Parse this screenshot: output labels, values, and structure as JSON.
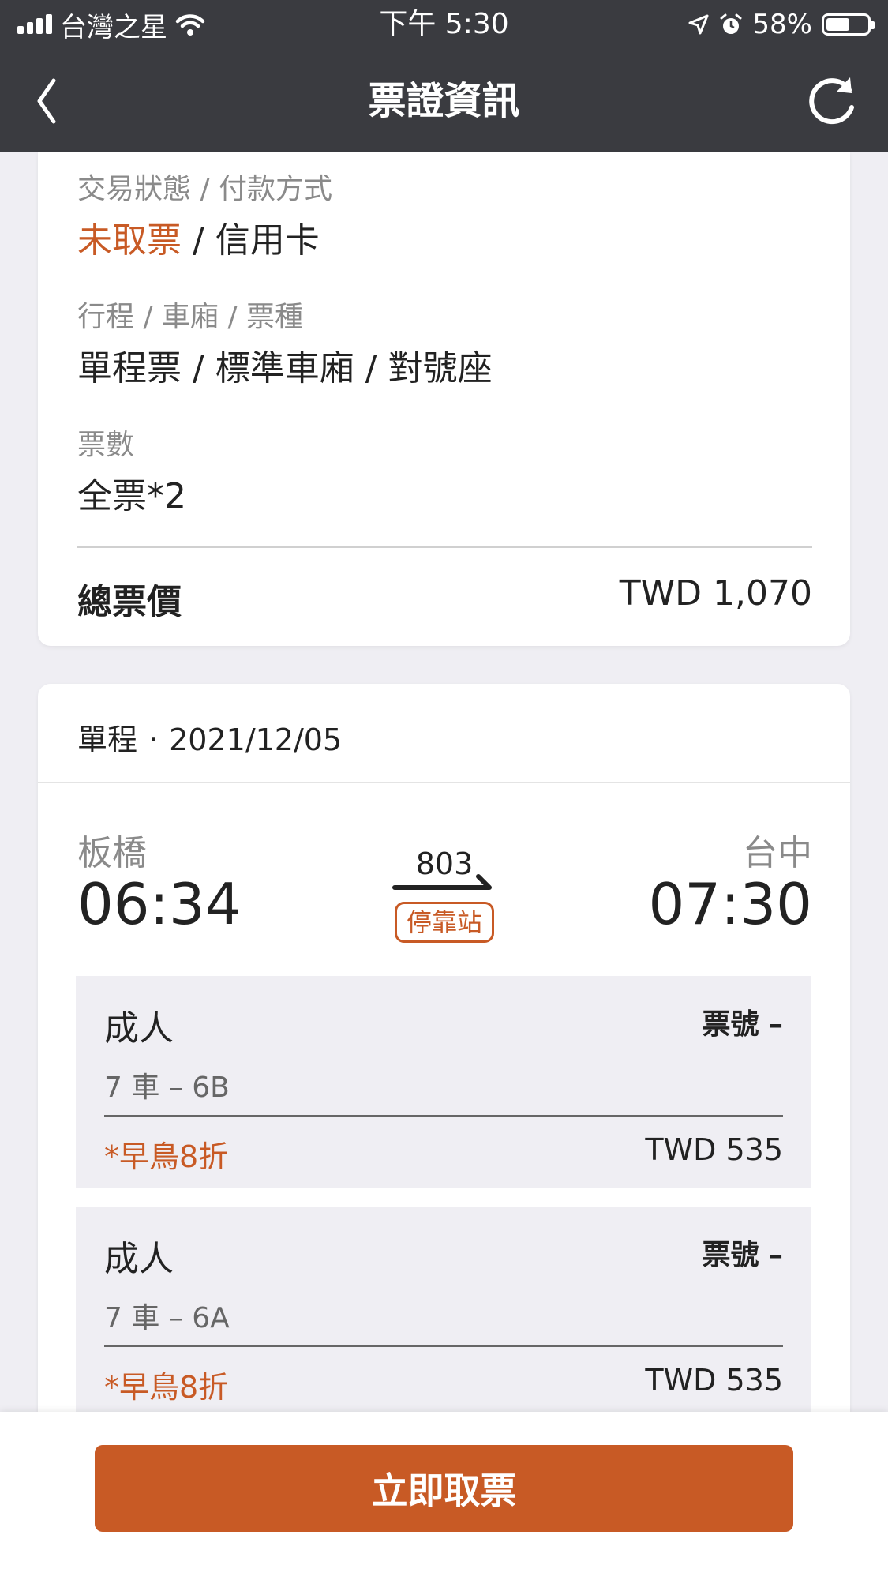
{
  "status_bar": {
    "carrier": "台灣之星",
    "time": "下午 5:30",
    "battery": "58%",
    "battery_level": 0.58
  },
  "nav": {
    "title": "票證資訊",
    "back_icon": "chevron-left-icon",
    "refresh_icon": "refresh-icon"
  },
  "summary": {
    "status_label": "交易狀態 / 付款方式",
    "status_value": "未取票",
    "status_sep": " / ",
    "payment_value": "信用卡",
    "trip_label": "行程 / 車廂 / 票種",
    "trip_value": "單程票 / 標準車廂 / 對號座",
    "count_label": "票數",
    "count_value": "全票*2",
    "total_label": "總票價",
    "total_value": "TWD 1,070"
  },
  "trip": {
    "header_type": "單程",
    "header_dot": "·",
    "header_date": "2021/12/05",
    "from_station": "板橋",
    "to_station": "台中",
    "depart_time": "06:34",
    "arrive_time": "07:30",
    "train_no": "803",
    "stop_badge": "停靠站",
    "passengers": [
      {
        "type": "成人",
        "ticket_no": "票號 –",
        "seat": "7 車 – 6B",
        "discount": "*早鳥8折",
        "price": "TWD 535"
      },
      {
        "type": "成人",
        "ticket_no": "票號 –",
        "seat": "7 車 – 6A",
        "discount": "*早鳥8折",
        "price": "TWD 535"
      }
    ]
  },
  "actions": {
    "pickup_button": "立即取票"
  },
  "colors": {
    "accent": "#c85a25",
    "header_bg": "#3a3b40",
    "page_bg": "#efeef3"
  }
}
